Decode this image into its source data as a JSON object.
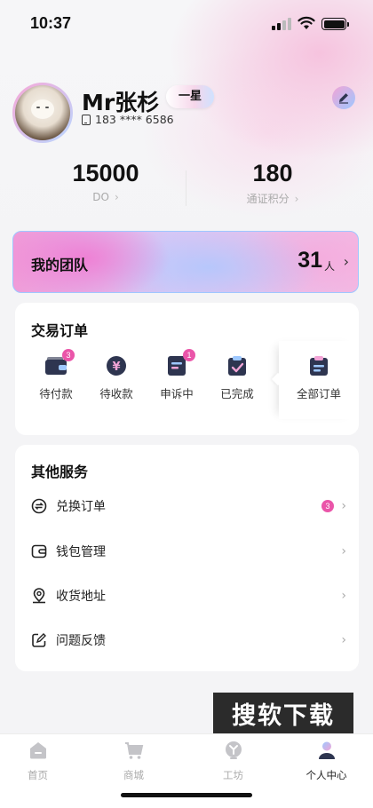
{
  "status_bar": {
    "time": "10:37"
  },
  "profile": {
    "username": "Mr张杉",
    "level": "一星",
    "phone": "183 **** 6586"
  },
  "stats": [
    {
      "value": "15000",
      "label": "DO"
    },
    {
      "value": "180",
      "label": "通证积分"
    }
  ],
  "team": {
    "title": "我的团队",
    "count": "31",
    "unit": "人"
  },
  "orders": {
    "title": "交易订单",
    "items": [
      {
        "label": "待付款",
        "badge": "3",
        "icon": "wallet-icon"
      },
      {
        "label": "待收款",
        "badge": "",
        "icon": "yen-coin-icon"
      },
      {
        "label": "申诉中",
        "badge": "1",
        "icon": "appeal-document-icon"
      },
      {
        "label": "已完成",
        "badge": "",
        "icon": "completed-clipboard-icon"
      },
      {
        "label": "全部订单",
        "badge": "",
        "icon": "all-orders-clipboard-icon"
      }
    ]
  },
  "services": {
    "title": "其他服务",
    "items": [
      {
        "label": "兑换订单",
        "badge": "3",
        "icon": "exchange-icon"
      },
      {
        "label": "钱包管理",
        "badge": "",
        "icon": "wallet-outline-icon"
      },
      {
        "label": "收货地址",
        "badge": "",
        "icon": "location-pin-icon"
      },
      {
        "label": "问题反馈",
        "badge": "",
        "icon": "feedback-edit-icon"
      }
    ]
  },
  "watermark": "搜软下载",
  "tabbar": [
    {
      "label": "首页",
      "icon": "home-icon",
      "active": false
    },
    {
      "label": "商城",
      "icon": "cart-icon",
      "active": false
    },
    {
      "label": "工坊",
      "icon": "workshop-icon",
      "active": false
    },
    {
      "label": "个人中心",
      "icon": "user-icon",
      "active": true
    }
  ],
  "colors": {
    "accent_pink": "#ea55a9",
    "icon_dark": "#2e3550",
    "active_gradient": [
      "#9ec8ff",
      "#f2a4d6"
    ]
  }
}
